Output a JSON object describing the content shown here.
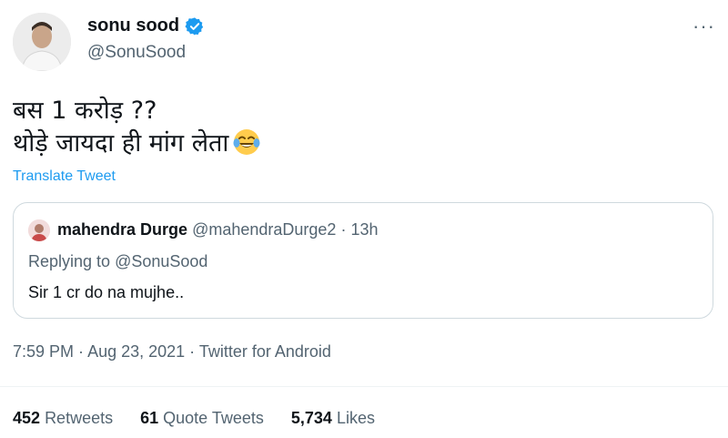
{
  "author": {
    "name": "sonu sood",
    "handle": "@SonuSood",
    "verified": true
  },
  "tweet": {
    "line1": "बस 1 करोड़  ??",
    "line2": "थोड़े जायदा ही मांग लेता",
    "emoji": "face-with-tears-of-joy",
    "translate_label": "Translate Tweet"
  },
  "quoted_tweet": {
    "name": "mahendra Durge",
    "handle": "@mahendraDurge2",
    "separator": " · ",
    "time": "13h",
    "replying_prefix": "Replying to ",
    "replying_to": "@SonuSood",
    "text": "Sir 1 cr do na mujhe.."
  },
  "meta": {
    "time": "7:59 PM",
    "separator": " · ",
    "date": "Aug 23, 2021",
    "source": "Twitter for Android"
  },
  "stats": {
    "retweets_count": "452",
    "retweets_label": "Retweets",
    "quotes_count": "61",
    "quotes_label": "Quote Tweets",
    "likes_count": "5,734",
    "likes_label": "Likes"
  },
  "colors": {
    "accent": "#1d9bf0",
    "secondary_text": "#536471",
    "border": "#cfd9de"
  }
}
